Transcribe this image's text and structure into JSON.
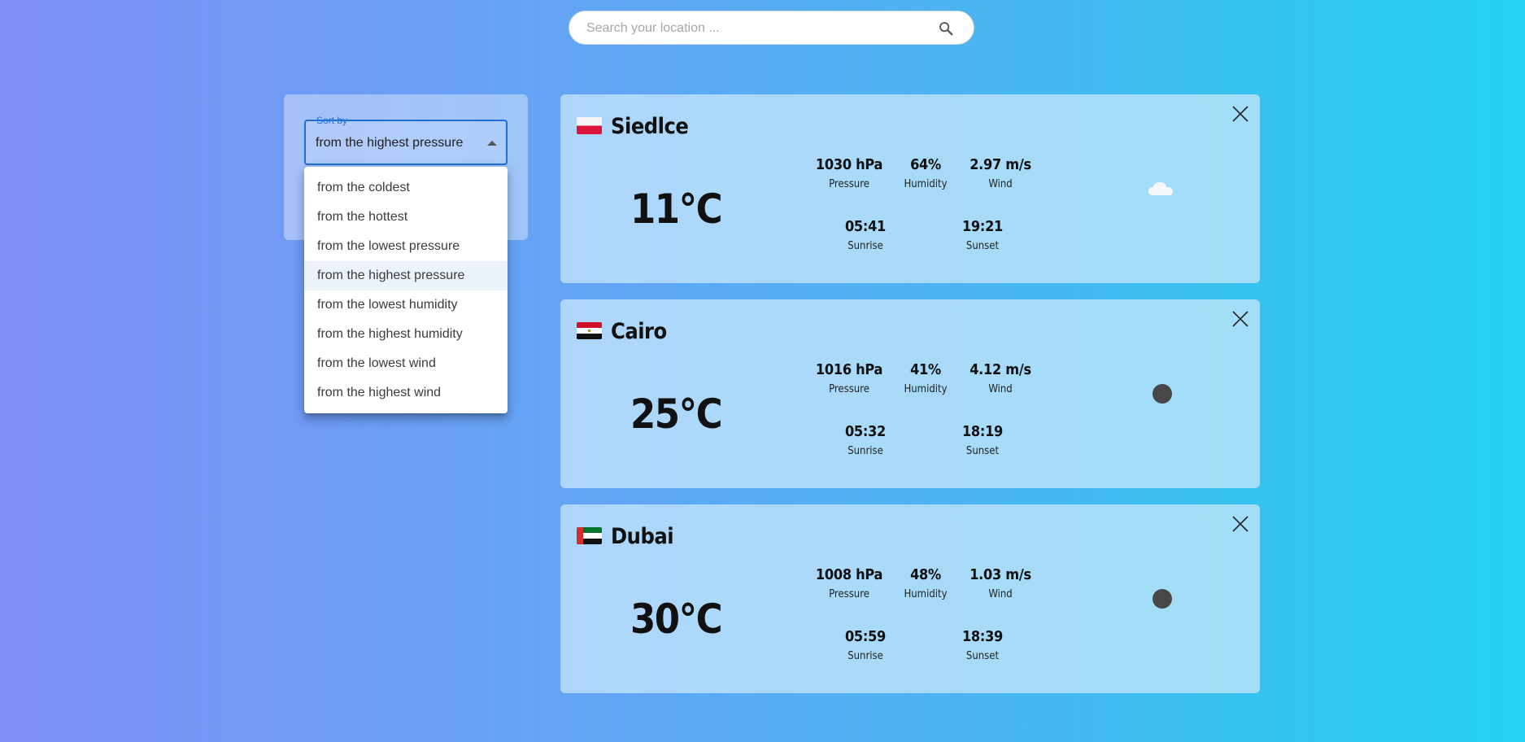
{
  "search": {
    "placeholder": "Search your location ..."
  },
  "sort": {
    "label": "Sort by",
    "selected": "from the highest pressure",
    "options": [
      "from the coldest",
      "from the hottest",
      "from the lowest pressure",
      "from the highest pressure",
      "from the lowest humidity",
      "from the highest humidity",
      "from the lowest wind",
      "from the highest wind"
    ]
  },
  "labels": {
    "pressure": "Pressure",
    "humidity": "Humidity",
    "wind": "Wind",
    "sunrise": "Sunrise",
    "sunset": "Sunset"
  },
  "cities": [
    {
      "name": "Siedlce",
      "flag": "poland-flag-icon",
      "temp": "11°C",
      "pressure": "1030 hPa",
      "humidity": "64%",
      "wind": "2.97 m/s",
      "sunrise": "05:41",
      "sunset": "19:21",
      "icon": "cloud-icon"
    },
    {
      "name": "Cairo",
      "flag": "egypt-flag-icon",
      "temp": "25°C",
      "pressure": "1016 hPa",
      "humidity": "41%",
      "wind": "4.12 m/s",
      "sunrise": "05:32",
      "sunset": "18:19",
      "icon": "moon-icon"
    },
    {
      "name": "Dubai",
      "flag": "uae-flag-icon",
      "temp": "30°C",
      "pressure": "1008 hPa",
      "humidity": "48%",
      "wind": "1.03 m/s",
      "sunrise": "05:59",
      "sunset": "18:39",
      "icon": "moon-icon"
    }
  ],
  "colors": {
    "accent": "#1f6fd6",
    "card_start": "#afd6fa",
    "card_end": "#a2def7",
    "moon": "#474747"
  }
}
